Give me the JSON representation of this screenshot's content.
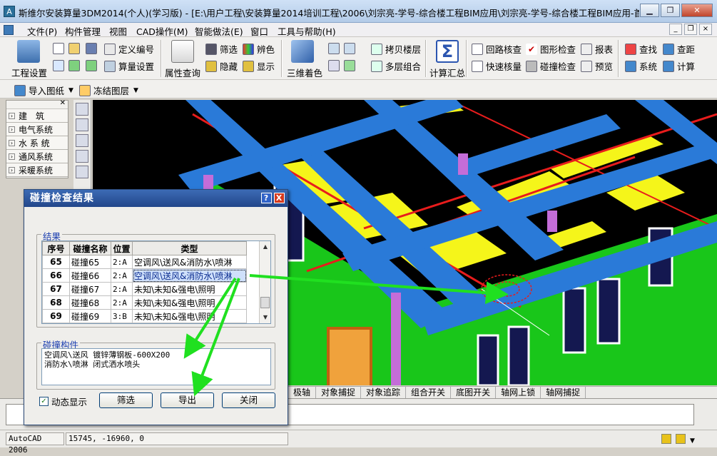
{
  "window": {
    "title": "斯维尔安装算量3DM2014(个人)(学习版) - [E:\\用户工程\\安装算量2014培训工程\\2006\\刘宗亮-学号-综合楼工程BIM应用\\刘宗亮-学号-综合楼工程BIM应用-首层...",
    "app_icon": "A",
    "buttons": [
      "▁",
      "❐",
      "✕"
    ]
  },
  "menu": {
    "items": [
      "文件(P)",
      "构件管理",
      "视图",
      "CAD操作(M)",
      "智能做法(E)",
      "窗口",
      "工具与帮助(H)"
    ],
    "mdi_buttons": [
      "_",
      "❐",
      "×"
    ]
  },
  "toolbar": {
    "project_settings": "工程设置",
    "define_number": "定义编号",
    "quantity_settings": "算量设置",
    "property_query": "属性查询",
    "filter": "筛选",
    "hide": "隐藏",
    "color": "辨色",
    "show": "显示",
    "color_3d": "三维着色",
    "copy_floor": "拷贝楼层",
    "multi_floor": "多层组合",
    "calc_summary": "计算汇总",
    "circuit_check": "回路核查",
    "graphic_check": "图形检查",
    "report": "报表",
    "quick_check": "快速核量",
    "collision_check": "碰撞检查",
    "preview": "预览",
    "find": "查找",
    "check_distance": "查距",
    "system": "系统",
    "calculate": "计算",
    "import_drawing": "导入图纸",
    "freeze_layer": "冻结图层"
  },
  "sidebar": {
    "items": [
      "建　筑",
      "电气系统",
      "水 系 统",
      "通风系统",
      "采暖系统"
    ]
  },
  "cad_status": [
    "极轴",
    "对象捕捉",
    "对象追踪",
    "组合开关",
    "底图开关",
    "轴网上锁",
    "轴网捕捉"
  ],
  "statusbar": {
    "app": "AutoCAD 2006",
    "coords": "15745, -16960, 0"
  },
  "dialog": {
    "title": "碰撞检查结果",
    "results_group": "结果",
    "columns": [
      "序号",
      "碰撞名称",
      "位置",
      "类型"
    ],
    "rows": [
      {
        "num": "65",
        "name": "碰撞65",
        "pos": "2:A",
        "type": "空调风\\送风&消防水\\喷淋"
      },
      {
        "num": "66",
        "name": "碰撞66",
        "pos": "2:A",
        "type": "空调风\\送风&消防水\\喷淋"
      },
      {
        "num": "67",
        "name": "碰撞67",
        "pos": "2:A",
        "type": "未知\\未知&强电\\照明"
      },
      {
        "num": "68",
        "name": "碰撞68",
        "pos": "2:A",
        "type": "未知\\未知&强电\\照明"
      },
      {
        "num": "69",
        "name": "碰撞69",
        "pos": "3:B",
        "type": "未知\\未知&强电\\照明"
      }
    ],
    "selected_row": 1,
    "components_group": "碰撞构件",
    "components_text": "空调风\\送风 镀锌薄钢板-600X200\n消防水\\喷淋 闭式洒水喷头",
    "dynamic_display": "动态显示",
    "dynamic_checked": true,
    "filter_btn": "筛选",
    "export_btn": "导出",
    "close_btn": "关闭",
    "help_btn": "?",
    "x_btn": "X"
  },
  "colors": {
    "title_bg": "#22468a",
    "wall_green": "#19c61a",
    "beam_blue": "#2a7ad8",
    "duct_yellow": "#f5f51a",
    "arrow_green": "#20e020",
    "pipe_red": "#e81c1c"
  }
}
